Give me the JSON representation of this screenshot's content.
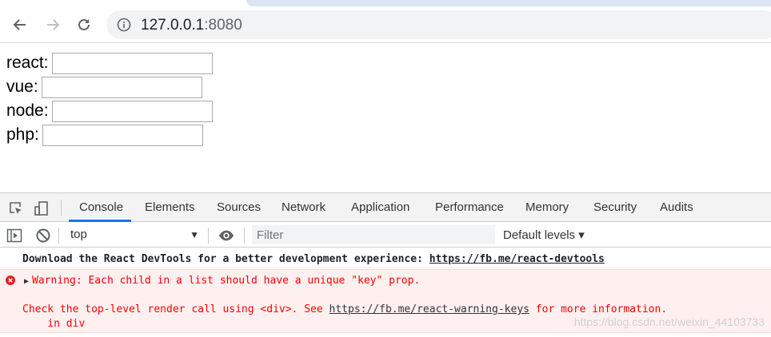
{
  "browser": {
    "url_host": "127.0.0.1",
    "url_port": ":8080",
    "icons": [
      "back-arrow-icon",
      "forward-arrow-icon",
      "reload-icon",
      "info-icon"
    ]
  },
  "form": {
    "fields": [
      {
        "label": "react:",
        "value": ""
      },
      {
        "label": "vue:",
        "value": ""
      },
      {
        "label": "node:",
        "value": ""
      },
      {
        "label": "php:",
        "value": ""
      }
    ]
  },
  "devtools": {
    "tabs": [
      "Console",
      "Elements",
      "Sources",
      "Network",
      "Application",
      "Performance",
      "Memory",
      "Security",
      "Audits"
    ],
    "active_tab": "Console",
    "context": "top",
    "filter_placeholder": "Filter",
    "levels_label": "Default levels",
    "accent": "#1a73e8"
  },
  "console": {
    "info_text": "Download the React DevTools for a better development experience: ",
    "info_link": "https://fb.me/react-devtools",
    "error_line1": "Warning: Each child in a list should have a unique \"key\" prop.",
    "error_line2_prefix": "Check the top-level render call using <div>. See ",
    "error_line2_link": "https://fb.me/react-warning-keys",
    "error_line2_suffix": " for more information.",
    "error_line3": "    in div",
    "error_color": "#fe0000"
  },
  "watermark": "https://blog.csdn.net/weixin_44103733"
}
